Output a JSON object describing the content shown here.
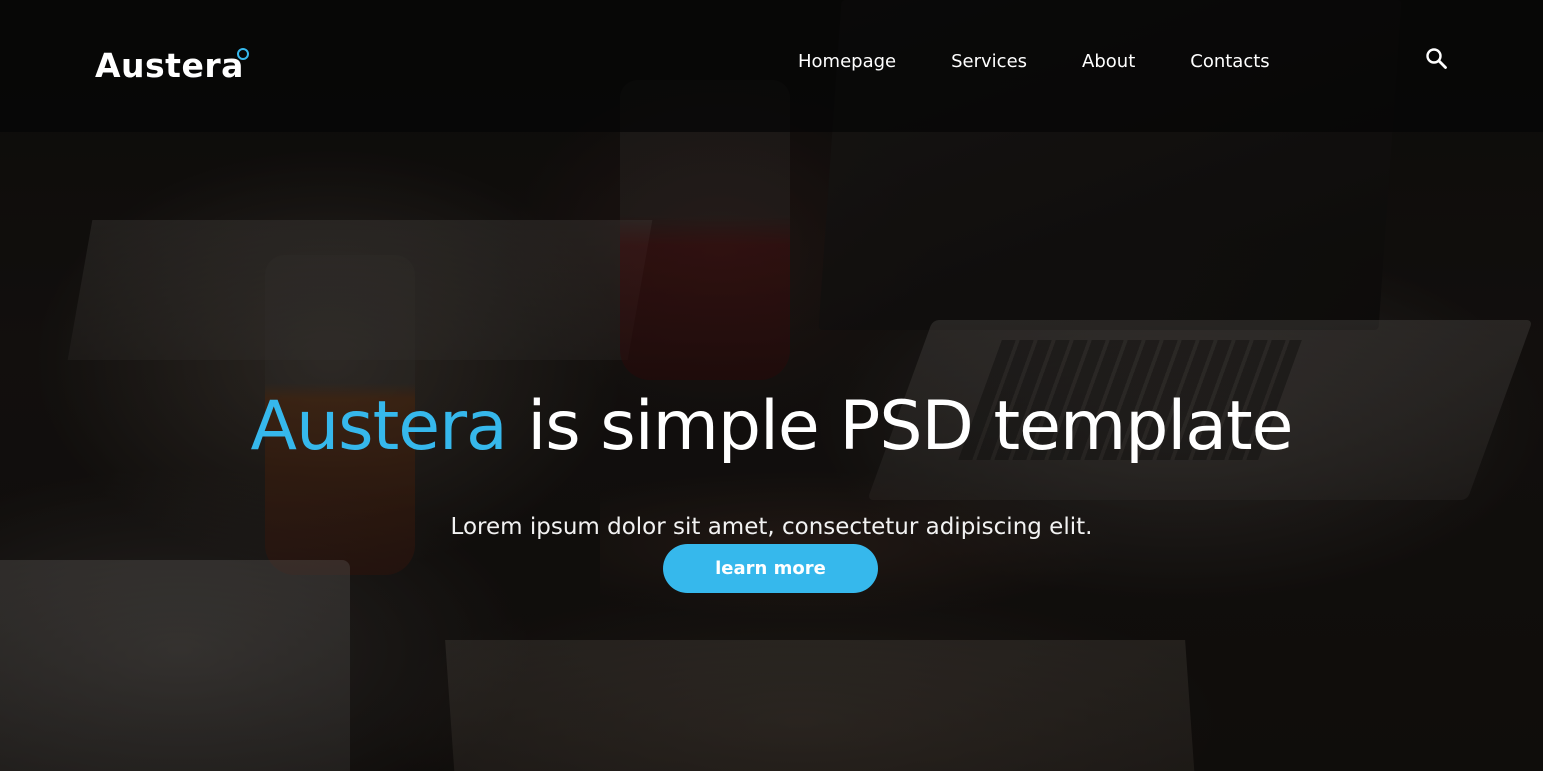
{
  "header": {
    "logo_text": "Austera",
    "nav": [
      {
        "label": "Homepage"
      },
      {
        "label": "Services"
      },
      {
        "label": "About"
      },
      {
        "label": "Contacts"
      }
    ],
    "search_icon": "search-icon"
  },
  "hero": {
    "title_accent": "Austera",
    "title_rest": " is simple PSD template",
    "subtitle": "Lorem ipsum dolor sit amet, consectetur adipiscing elit.",
    "cta_label": "learn more"
  },
  "colors": {
    "accent": "#36b8ec",
    "text": "#ffffff",
    "navbar_bg": "#060606"
  }
}
